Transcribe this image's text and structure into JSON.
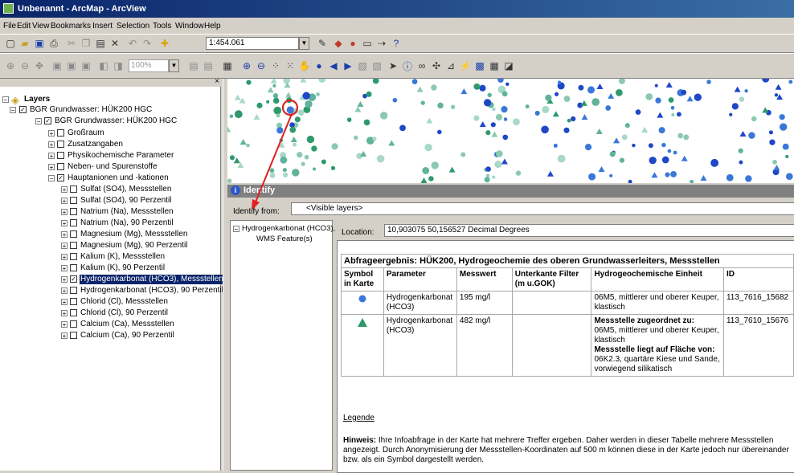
{
  "titlebar": {
    "title": "Unbenannt - ArcMap - ArcView"
  },
  "menu": {
    "items": [
      "File",
      "Edit",
      "View",
      "Bookmarks",
      "Insert",
      "Selection",
      "Tools",
      "Window",
      "Help"
    ]
  },
  "toolbar": {
    "scale": "1:454.061",
    "zoom": "100%"
  },
  "toc": {
    "root": "Layers",
    "service": "BGR Grundwasser: HÜK200 HGC",
    "group": "BGR Grundwasser: HÜK200 HGC",
    "categories": [
      "Großraum",
      "Zusatzangaben",
      "Physikochemische Parameter",
      "Neben- und Spurenstoffe",
      "Hauptanionen und -kationen"
    ],
    "layers": [
      "Sulfat (SO4), Messstellen",
      "Sulfat (SO4), 90 Perzentil",
      "Natrium (Na), Messstellen",
      "Natrium (Na), 90 Perzentil",
      "Magnesium (Mg), Messstellen",
      "Magnesium (Mg), 90 Perzentil",
      "Kalium (K), Messstellen",
      "Kalium (K), 90 Perzentil",
      "Hydrogenkarbonat (HCO3), Messstellen",
      "Hydrogenkarbonat (HCO3), 90 Perzentil",
      "Chlorid (Cl), Messstellen",
      "Chlorid (Cl), 90 Perzentil",
      "Calcium (Ca), Messstellen",
      "Calcium (Ca), 90 Perzentil"
    ]
  },
  "identify": {
    "title": "Identify",
    "from_label": "Identify from:",
    "from_value": "<Visible layers>",
    "tree_root": "Hydrogenkarbonat (HCO3),",
    "tree_child": "WMS Feature(s)",
    "location_label": "Location:",
    "location_value": "10,903075  50,156527 Decimal Degrees",
    "caption": "Abfrageergebnis: HÜK200, Hydrogeochemie des oberen Grundwasserleiters, Messstellen",
    "headers": [
      "Symbol in Karte",
      "Parameter",
      "Messwert",
      "Unterkante Filter (m u.GOK)",
      "Hydrogeochemische Einheit",
      "ID"
    ],
    "rows": [
      {
        "parameter": "Hydrogenkarbonat (HCO3)",
        "messwert": "195 mg/l",
        "filter": "",
        "einheit_plain": "06M5, mittlerer und oberer Keuper, klastisch",
        "id": "113_7616_15682"
      },
      {
        "parameter": "Hydrogenkarbonat (HCO3)",
        "messwert": "482 mg/l",
        "filter": "",
        "einheit_b1": "Messstelle zugeordnet zu:",
        "einheit_t1": "06M5, mittlerer und oberer Keuper, klastisch",
        "einheit_b2": "Messstelle liegt auf Fläche von:",
        "einheit_t2": "06K2.3, quartäre Kiese und Sande, vorwiegend silikatisch",
        "id": "113_7610_15676"
      }
    ],
    "legende": "Legende",
    "hinweis_label": "Hinweis:",
    "hinweis_text": "Ihre Infoabfrage in der Karte hat mehrere Treffer ergeben. Daher werden in dieser Tabelle mehrere Messstellen angezeigt. Durch Anonymisierung der Messstellen-Koordinaten auf 500 m können diese in der Karte jedoch nur übereinander bzw. als ein Symbol dargestellt werden."
  },
  "colors": {
    "circle_symbol": "#3a78d8",
    "triangle_symbol": "#2e9a6c",
    "annotation": "#e02020"
  }
}
